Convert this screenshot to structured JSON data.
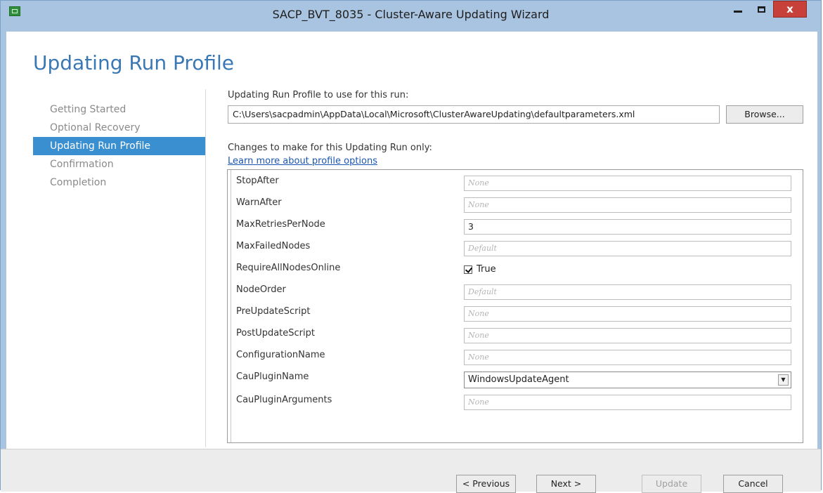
{
  "window": {
    "title": "SACP_BVT_8035 - Cluster-Aware Updating Wizard",
    "close_glyph": "x"
  },
  "page": {
    "heading": "Updating Run Profile"
  },
  "steps": [
    {
      "label": "Getting Started",
      "active": false
    },
    {
      "label": "Optional Recovery",
      "active": false
    },
    {
      "label": "Updating Run Profile",
      "active": true
    },
    {
      "label": "Confirmation",
      "active": false
    },
    {
      "label": "Completion",
      "active": false
    }
  ],
  "profile": {
    "label": "Updating Run Profile to use for this run:",
    "path_value": "C:\\Users\\sacpadmin\\AppData\\Local\\Microsoft\\ClusterAwareUpdating\\defaultparameters.xml",
    "browse_label": "Browse..."
  },
  "changes": {
    "label": "Changes to make for this Updating Run only:",
    "learn_more_link": "Learn more about profile options"
  },
  "parameters": [
    {
      "name": "StopAfter",
      "kind": "placeholder",
      "value": "None"
    },
    {
      "name": "WarnAfter",
      "kind": "placeholder",
      "value": "None"
    },
    {
      "name": "MaxRetriesPerNode",
      "kind": "value",
      "value": "3"
    },
    {
      "name": "MaxFailedNodes",
      "kind": "placeholder",
      "value": "Default"
    },
    {
      "name": "RequireAllNodesOnline",
      "kind": "checkbox",
      "value": "True",
      "checked": true
    },
    {
      "name": "NodeOrder",
      "kind": "placeholder",
      "value": "Default"
    },
    {
      "name": "PreUpdateScript",
      "kind": "placeholder",
      "value": "None"
    },
    {
      "name": "PostUpdateScript",
      "kind": "placeholder",
      "value": "None"
    },
    {
      "name": "ConfigurationName",
      "kind": "placeholder",
      "value": "None"
    },
    {
      "name": "CauPluginName",
      "kind": "select",
      "value": "WindowsUpdateAgent"
    },
    {
      "name": "CauPluginArguments",
      "kind": "placeholder",
      "value": "None"
    }
  ],
  "footer": {
    "previous_label": "< Previous",
    "next_label": "Next >",
    "update_label": "Update",
    "cancel_label": "Cancel"
  },
  "colors": {
    "accent": "#3a8fd0",
    "heading": "#3a78b5",
    "frame": "#a9c4e0",
    "close_button": "#c7413a"
  }
}
